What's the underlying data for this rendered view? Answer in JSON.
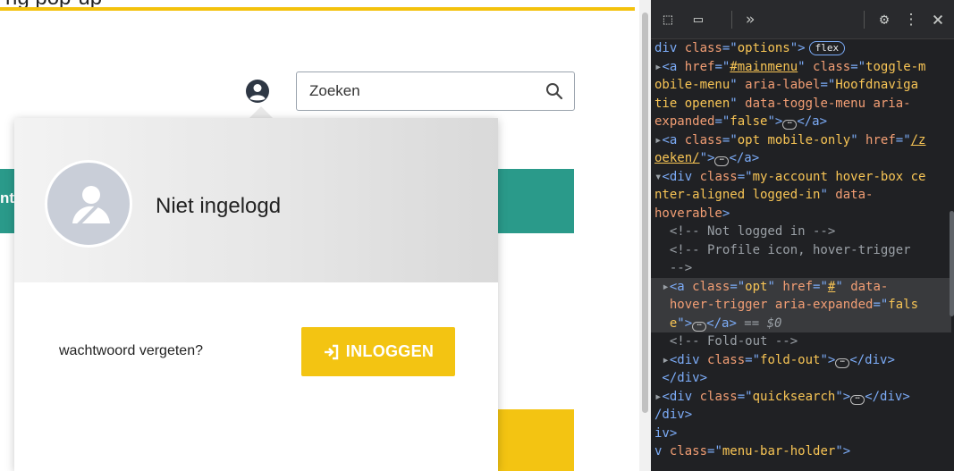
{
  "site": {
    "top_text_fragment": "ng pop-up",
    "teal_fragment": "nt",
    "search": {
      "placeholder": "Zoeken"
    },
    "login": {
      "status": "Niet ingelogd",
      "forgot_label": "wachtwoord vergeten?",
      "button_label": "INLOGGEN"
    }
  },
  "devtools": {
    "toolbar": {
      "inspect": "⬚",
      "device": "▭",
      "more_panels": "»",
      "settings": "⚙",
      "menu": "⋮",
      "close": "×"
    },
    "lines": [
      {
        "parts": [
          [
            "tg",
            "div "
          ],
          [
            "at",
            "class"
          ],
          [
            "tg",
            "=\""
          ],
          [
            "vl",
            "options"
          ],
          [
            "tg",
            "\">"
          ]
        ],
        "badge": "flex"
      },
      {
        "parts": [
          [
            "pn",
            "▸"
          ],
          [
            "tg",
            "<a "
          ],
          [
            "at",
            "href"
          ],
          [
            "tg",
            "=\""
          ],
          [
            "lk",
            "#mainmenu"
          ],
          [
            "tg",
            "\" "
          ],
          [
            "at",
            "class"
          ],
          [
            "tg",
            "=\""
          ],
          [
            "vl",
            "toggle-m"
          ]
        ]
      },
      {
        "parts": [
          [
            "vl",
            "obile-menu"
          ],
          [
            "tg",
            "\" "
          ],
          [
            "at",
            "aria-label"
          ],
          [
            "tg",
            "=\""
          ],
          [
            "vl",
            "Hoofdnaviga"
          ]
        ]
      },
      {
        "parts": [
          [
            "vl",
            "tie openen"
          ],
          [
            "tg",
            "\" "
          ],
          [
            "at",
            "data-toggle-menu aria-"
          ]
        ]
      },
      {
        "parts": [
          [
            "at",
            "expanded"
          ],
          [
            "tg",
            "=\""
          ],
          [
            "vl",
            "false"
          ],
          [
            "tg",
            "\">"
          ],
          [
            "ell",
            ""
          ],
          [
            "tg",
            "</a>"
          ]
        ]
      },
      {
        "parts": [
          [
            "pn",
            "▸"
          ],
          [
            "tg",
            "<a "
          ],
          [
            "at",
            "class"
          ],
          [
            "tg",
            "=\""
          ],
          [
            "vl",
            "opt mobile-only"
          ],
          [
            "tg",
            "\" "
          ],
          [
            "at",
            "href"
          ],
          [
            "tg",
            "=\""
          ],
          [
            "lk",
            "/z"
          ]
        ]
      },
      {
        "parts": [
          [
            "lk",
            "oeken/"
          ],
          [
            "tg",
            "\">"
          ],
          [
            "ell",
            ""
          ],
          [
            "tg",
            "</a>"
          ]
        ]
      },
      {
        "parts": [
          [
            "pn",
            "▾"
          ],
          [
            "tg",
            "<div "
          ],
          [
            "at",
            "class"
          ],
          [
            "tg",
            "=\""
          ],
          [
            "vl",
            "my-account hover-box ce"
          ]
        ]
      },
      {
        "parts": [
          [
            "vl",
            "nter-aligned logged-in"
          ],
          [
            "tg",
            "\" "
          ],
          [
            "at",
            "data-"
          ]
        ]
      },
      {
        "parts": [
          [
            "at",
            "hoverable"
          ],
          [
            "tg",
            ">"
          ]
        ]
      },
      {
        "parts": [
          [
            "cm",
            "  <!-- Not logged in -->"
          ]
        ]
      },
      {
        "parts": [
          [
            "cm",
            "  <!-- Profile icon, hover-trigger"
          ]
        ]
      },
      {
        "parts": [
          [
            "cm",
            "  -->"
          ]
        ]
      },
      {
        "parts": [
          [
            "pn",
            " ▸"
          ],
          [
            "tg",
            "<a "
          ],
          [
            "at",
            "class"
          ],
          [
            "tg",
            "=\""
          ],
          [
            "vl",
            "opt"
          ],
          [
            "tg",
            "\" "
          ],
          [
            "at",
            "href"
          ],
          [
            "tg",
            "=\""
          ],
          [
            "lk",
            "#"
          ],
          [
            "tg",
            "\" "
          ],
          [
            "at",
            "data-"
          ]
        ],
        "selected": true
      },
      {
        "parts": [
          [
            "at",
            "  hover-trigger aria-expanded"
          ],
          [
            "tg",
            "=\""
          ],
          [
            "vl",
            "fals"
          ]
        ],
        "selected": true
      },
      {
        "parts": [
          [
            "vl",
            "  e"
          ],
          [
            "tg",
            "\">"
          ],
          [
            "ell",
            ""
          ],
          [
            "tg",
            "</a>"
          ],
          [
            "eq",
            " == $0"
          ]
        ],
        "selected": true
      },
      {
        "parts": [
          [
            "cm",
            "  <!-- Fold-out -->"
          ]
        ]
      },
      {
        "parts": [
          [
            "pn",
            " ▸"
          ],
          [
            "tg",
            "<div "
          ],
          [
            "at",
            "class"
          ],
          [
            "tg",
            "=\""
          ],
          [
            "vl",
            "fold-out"
          ],
          [
            "tg",
            "\">"
          ],
          [
            "ell",
            ""
          ],
          [
            "tg",
            "</div>"
          ]
        ]
      },
      {
        "parts": [
          [
            "tg",
            " </div>"
          ]
        ]
      },
      {
        "parts": [
          [
            "pn",
            "▸"
          ],
          [
            "tg",
            "<div "
          ],
          [
            "at",
            "class"
          ],
          [
            "tg",
            "=\""
          ],
          [
            "vl",
            "quicksearch"
          ],
          [
            "tg",
            "\">"
          ],
          [
            "ell",
            ""
          ],
          [
            "tg",
            "</div>"
          ]
        ]
      },
      {
        "parts": [
          [
            "tg",
            "/div>"
          ]
        ]
      },
      {
        "parts": [
          [
            "tg",
            "iv>"
          ]
        ]
      },
      {
        "parts": [
          [
            "tg",
            "v "
          ],
          [
            "at",
            "class"
          ],
          [
            "tg",
            "=\""
          ],
          [
            "vl",
            "menu-bar-holder"
          ],
          [
            "tg",
            "\">"
          ]
        ]
      }
    ]
  }
}
